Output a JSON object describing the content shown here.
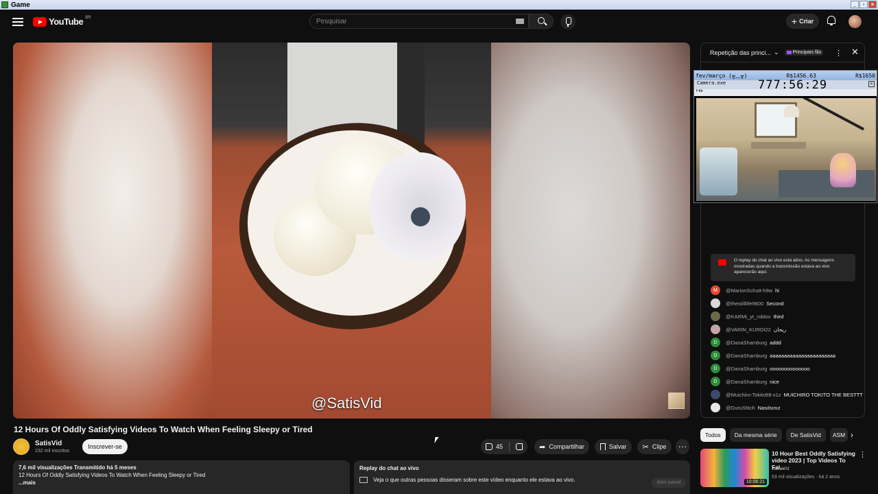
{
  "window": {
    "title": "Game"
  },
  "header": {
    "logo_text": "YouTube",
    "logo_country": "BR",
    "search_placeholder": "Pesquisar",
    "create_label": "Criar"
  },
  "video": {
    "watermark": "@SatisVid",
    "title": "12 Hours Of Oddly Satisfying Videos To Watch When Feeling Sleepy or Tired",
    "channel_name": "SatisVid",
    "channel_subs": "232 mil inscritos",
    "subscribe_label": "Inscrever-se",
    "like_count": "45",
    "share_label": "Compartilhar",
    "save_label": "Salvar",
    "clip_label": "Clipe"
  },
  "description": {
    "stats": "7,6 mil visualizações  Transmitido há 5 meses",
    "line": "12 Hours Of Oddly Satisfying Videos To Watch When Feeling Sleepy or Tired",
    "more": "...mais"
  },
  "replay_panel": {
    "title": "Replay do chat ao vivo",
    "text": "Veja o que outras pessoas disseram sobre este vídeo enquanto ele estava ao vivo.",
    "button": "Abrir painel"
  },
  "chat": {
    "header_title": "Repetição das princi...",
    "badge": "Principais fãs",
    "info": "O replay do chat ao vivo está ativo. As mensagens mostradas quando a transmissão estava ao vivo aparecerão aqui.",
    "messages": [
      {
        "initial": "M",
        "color": "#e2492f",
        "author": "@MarionSchutt-h9w",
        "text": "hi"
      },
      {
        "initial": "",
        "color": "#d9d9d9",
        "author": "@thestilllife9600",
        "text": "Second"
      },
      {
        "initial": "",
        "color": "#6a6a4a",
        "author": "@KARMi_yt_roblox",
        "text": "third"
      },
      {
        "initial": "",
        "color": "#c4a4a8",
        "author": "@VARIN_KURDI22",
        "text": "ریحان"
      },
      {
        "initial": "D",
        "color": "#2e8b3a",
        "author": "@DanaShamburg",
        "text": "addd"
      },
      {
        "initial": "D",
        "color": "#2e8b3a",
        "author": "@DanaShamburg",
        "text": "aaaaaaaaaaaaaaaaaaaaaaa"
      },
      {
        "initial": "D",
        "color": "#2e8b3a",
        "author": "@DanaShamburg",
        "text": "oooooooooooooo"
      },
      {
        "initial": "D",
        "color": "#2e8b3a",
        "author": "@DanaShamburg",
        "text": "nice"
      },
      {
        "initial": "",
        "color": "#3a4a6a",
        "author": "@Muichiro-Tokito88-x1z",
        "text": "MUICHIRO TOKITO THE BESTTT"
      },
      {
        "initial": "",
        "color": "#e8e8e8",
        "author": "@DuruStitch",
        "text": "Nasılsınız"
      }
    ]
  },
  "overlay": {
    "left_label": "fev/março (╥﹏╥)",
    "mid_value": "R$1456.63",
    "right_value": "R$1650",
    "window_title": "Camera.exe",
    "menu": "File",
    "timer": "777:56:29"
  },
  "chips": [
    "Todos",
    "Da mesma série",
    "De SatisVid",
    "ASM"
  ],
  "recommendation": {
    "title": "10 Hour Best Oddly Satisfying video 2023 | Top Videos To Fal...",
    "channel": "SatisVid",
    "meta": "53 mil visualizações · há 2 anos",
    "duration": "10:06:21"
  }
}
